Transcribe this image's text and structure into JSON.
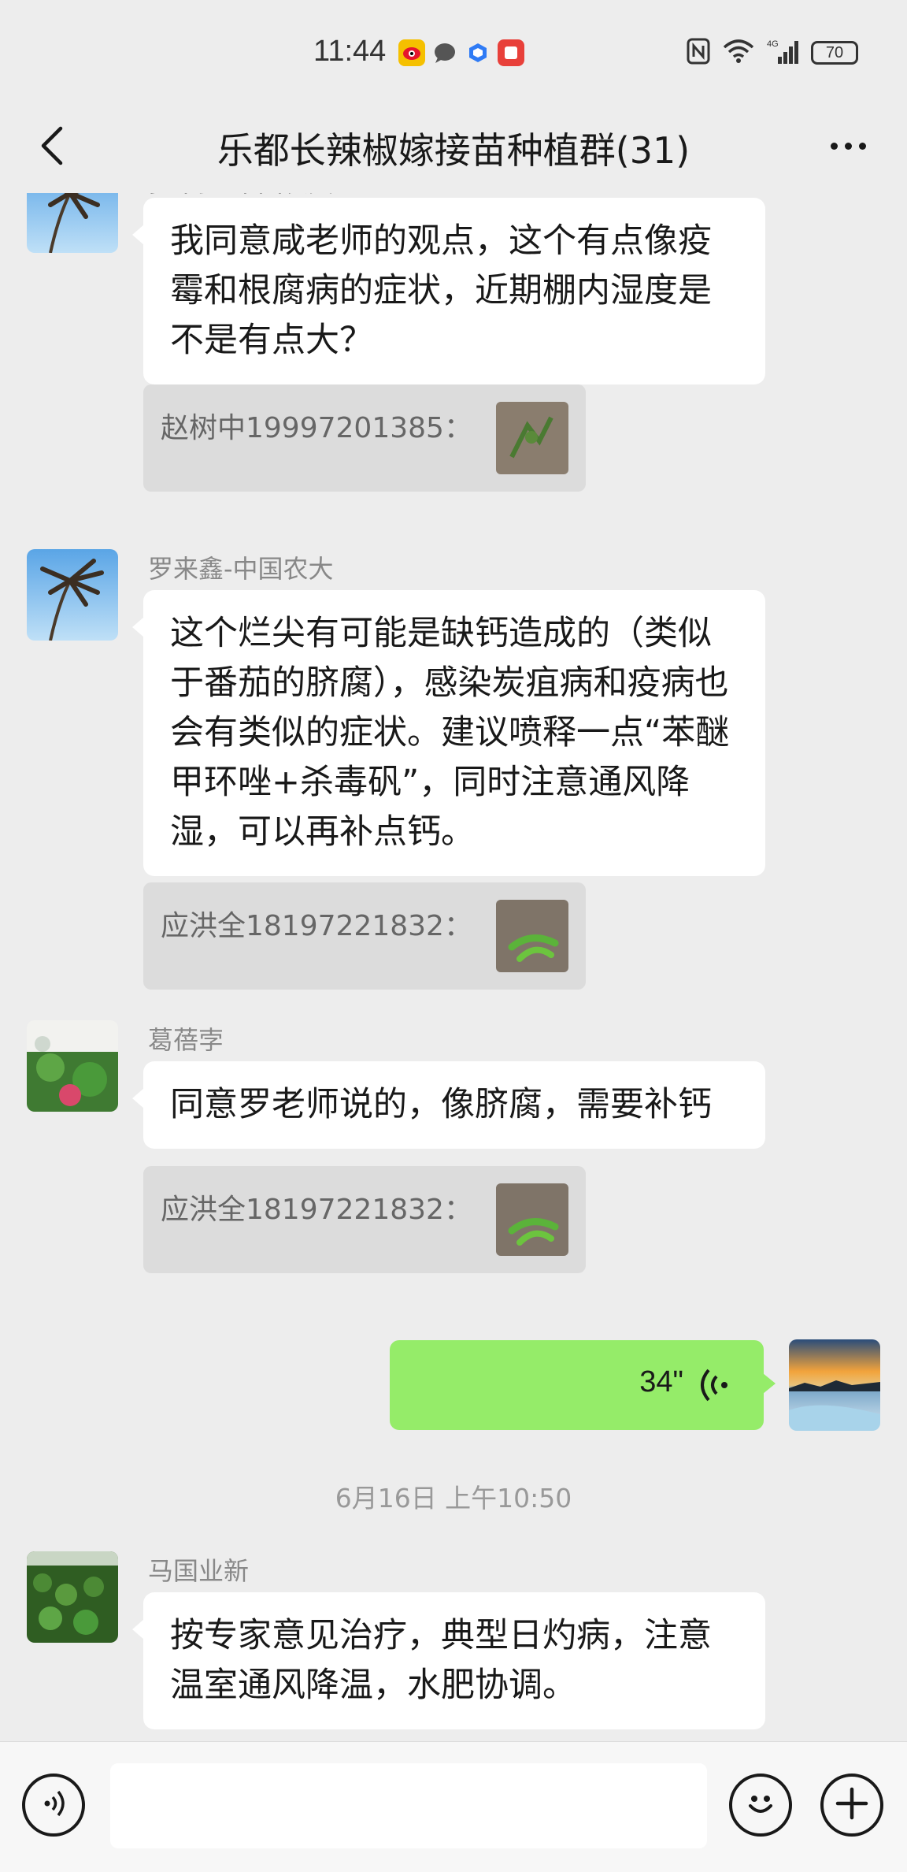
{
  "status_bar": {
    "time": "11:44",
    "notification_icons": [
      "weibo-icon",
      "message-icon",
      "app-icon",
      "notes-icon"
    ],
    "right_icons": [
      "nfc-icon",
      "wifi-icon",
      "signal-4g-icon"
    ],
    "battery": "70"
  },
  "header": {
    "title": "乐都长辣椒嫁接苗种植群(31)",
    "back_icon": "chevron-left-icon",
    "more_icon": "more-dots-icon"
  },
  "messages": [
    {
      "sender": "罗来鑫-中国农大",
      "text": "我同意咸老师的观点，这个有点像疫霉和根腐病的症状，近期棚内湿度是不是有点大？",
      "quote": "赵树中19997201385："
    },
    {
      "sender": "罗来鑫-中国农大",
      "text": "这个烂尖有可能是缺钙造成的（类似于番茄的脐腐），感染炭疽病和疫病也会有类似的症状。建议喷释一点“苯醚甲环唑+杀毒矾”，同时注意通风降湿，可以再补点钙。",
      "quote": "应洪全18197221832："
    },
    {
      "sender": "葛蓓孛",
      "text": "同意罗老师说的，像脐腐，需要补钙",
      "quote": "应洪全18197221832："
    },
    {
      "self_voice_duration": "34\""
    },
    {
      "timestamp": "6月16日 上午10:50"
    },
    {
      "sender": "马国业新",
      "text": "按专家意见治疗，典型日灼病，注意温室通风降温，水肥协调。"
    }
  ],
  "input_bar": {
    "voice_icon": "voice-input-icon",
    "emoji_icon": "emoji-icon",
    "plus_icon": "plus-icon",
    "placeholder": ""
  },
  "colors": {
    "background": "#ededed",
    "self_bubble": "#95ec69",
    "other_bubble": "#ffffff",
    "quote_bg": "#dcdcdc"
  }
}
